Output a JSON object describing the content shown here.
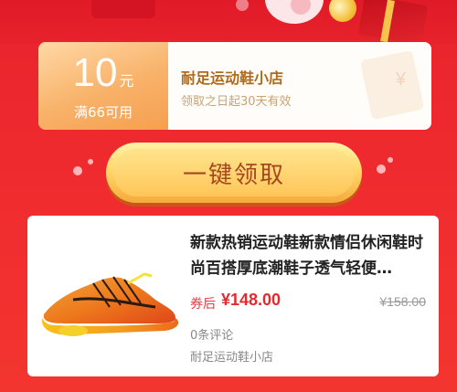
{
  "coupon": {
    "amount": "10",
    "unit": "元",
    "condition": "满66可用",
    "shop_name": "耐足运动鞋小店",
    "validity": "领取之日起30天有效",
    "deco_mark": "¥"
  },
  "claim_button": {
    "label": "一键领取"
  },
  "product": {
    "title": "新款热销运动鞋新款情侣休闲鞋时尚百搭厚底潮鞋子透气轻便…",
    "price_label": "券后",
    "price": "¥148.00",
    "original_price": "¥158.00",
    "reviews": "0条评论",
    "shop": "耐足运动鞋小店",
    "image_icon": "sneaker-icon"
  },
  "colors": {
    "background_red": "#ef2a2f",
    "coupon_orange": "#f8b269",
    "button_gold": "#ffc659",
    "price_red": "#e42a2f"
  }
}
